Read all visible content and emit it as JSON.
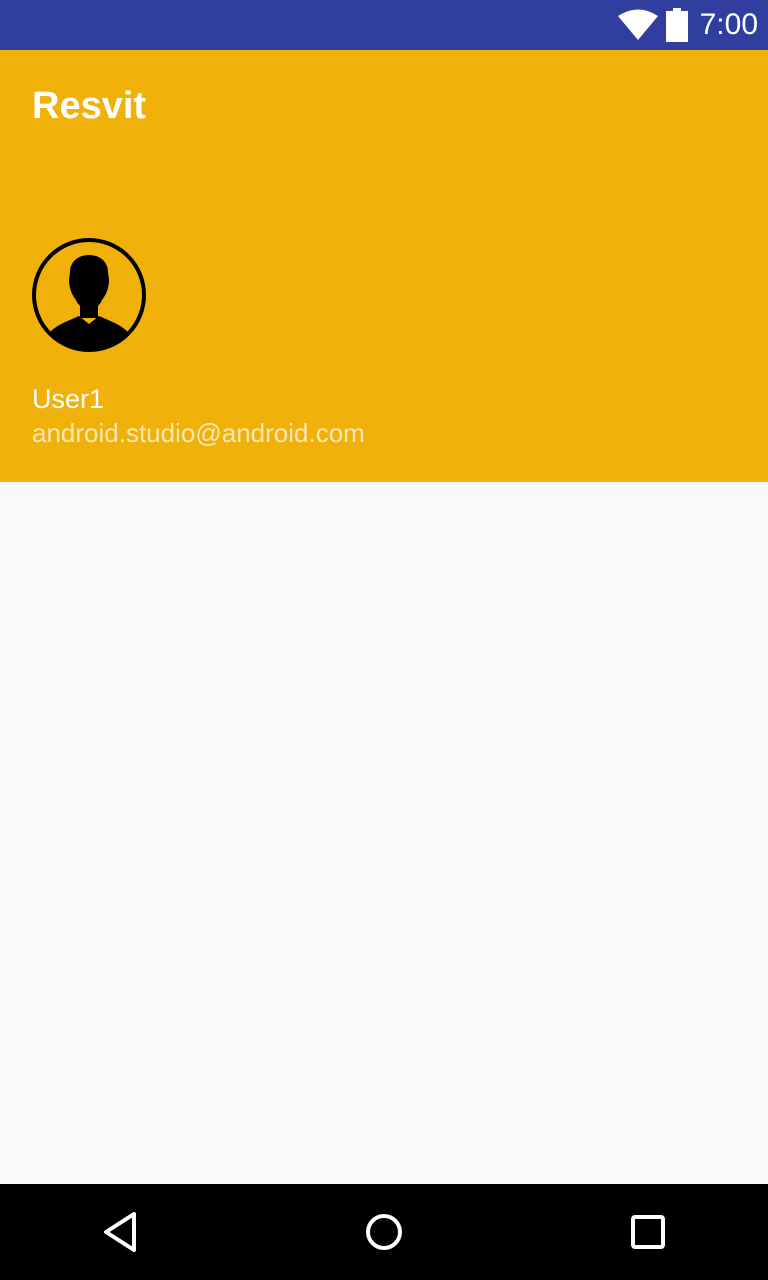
{
  "status_bar": {
    "time": "7:00",
    "wifi_icon": "wifi-icon",
    "battery_icon": "battery-icon",
    "color": "#303f9f"
  },
  "header": {
    "app_title": "Resvit",
    "avatar_icon": "person-avatar-icon",
    "user_name": "User1",
    "user_email": "android.studio@android.com",
    "color": "#efb10a"
  },
  "nav_bar": {
    "back_icon": "back-triangle-icon",
    "home_icon": "home-circle-icon",
    "recents_icon": "recents-square-icon"
  }
}
